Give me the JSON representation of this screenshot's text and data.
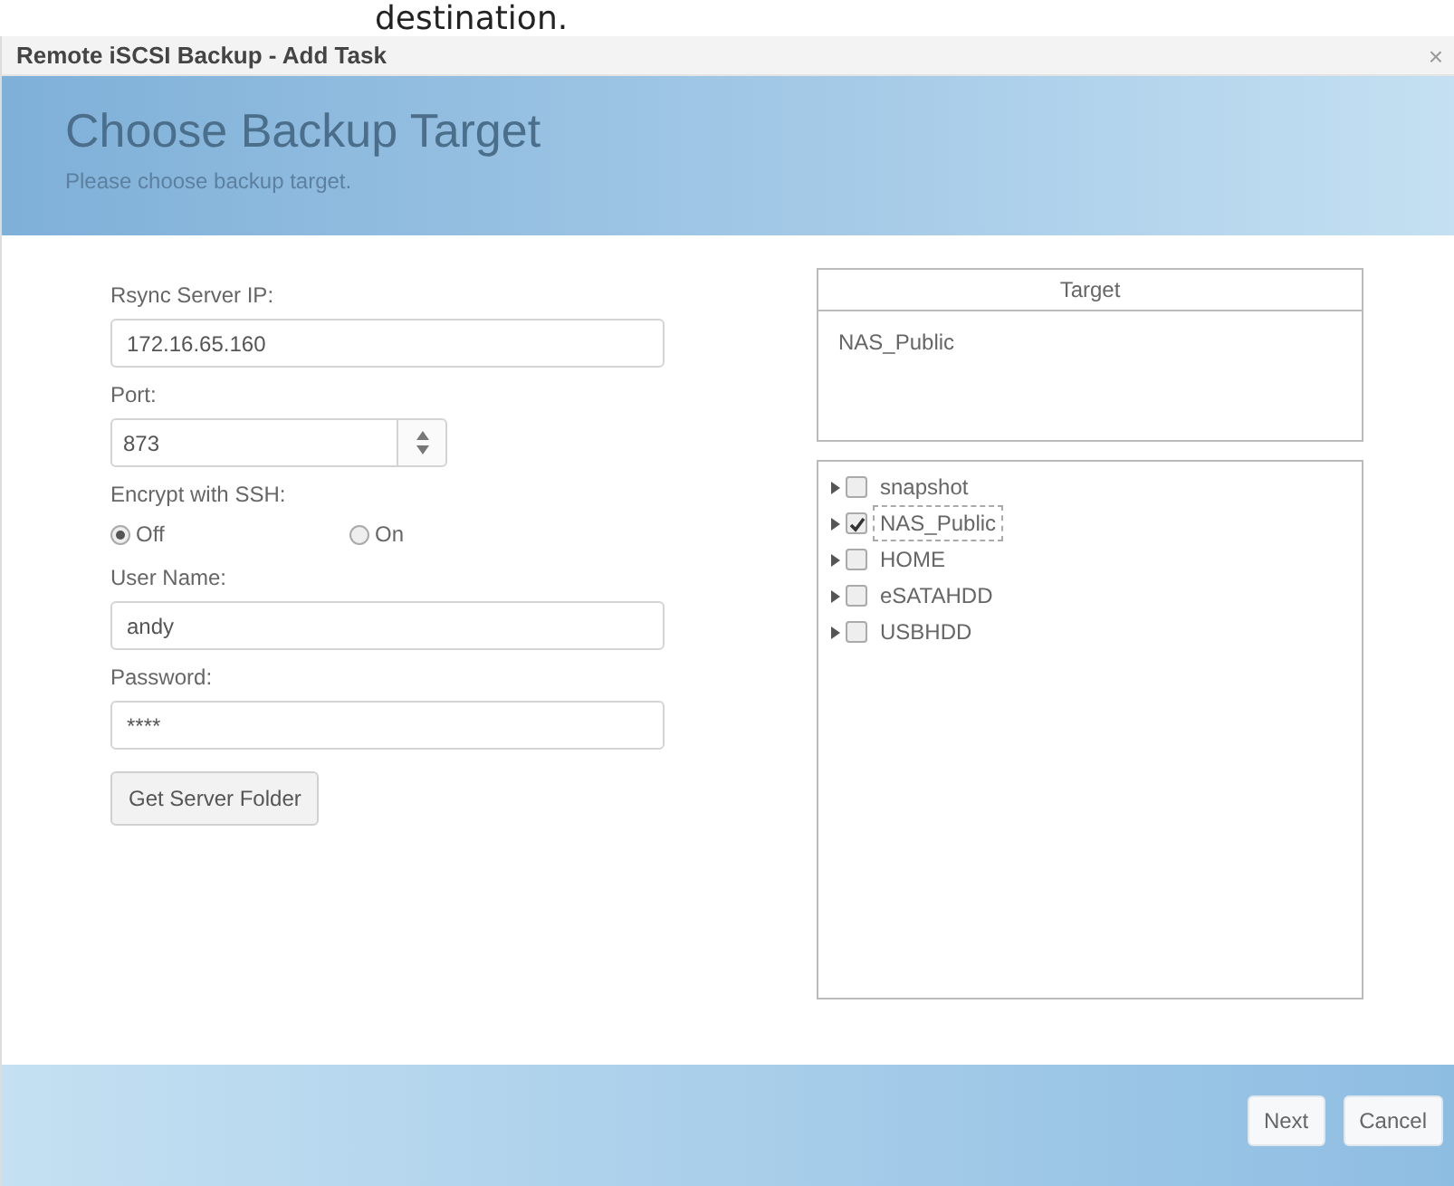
{
  "page_caption": "destination.",
  "window": {
    "title": "Remote iSCSI Backup - Add Task",
    "close": "×"
  },
  "header": {
    "title": "Choose Backup Target",
    "subtitle": "Please choose backup target."
  },
  "form": {
    "server_ip": {
      "label": "Rsync Server IP:",
      "value": "172.16.65.160"
    },
    "port": {
      "label": "Port:",
      "value": "873"
    },
    "encrypt": {
      "label": "Encrypt with SSH:",
      "options": [
        {
          "label": "Off",
          "selected": true
        },
        {
          "label": "On",
          "selected": false
        }
      ]
    },
    "user_name": {
      "label": "User Name:",
      "value": "andy"
    },
    "password": {
      "label": "Password:",
      "value": "****"
    },
    "get_folder_button": "Get Server Folder"
  },
  "target": {
    "heading": "Target",
    "value": "NAS_Public"
  },
  "folders": [
    {
      "label": "snapshot",
      "checked": false,
      "selected": false,
      "expanded": false
    },
    {
      "label": "NAS_Public",
      "checked": true,
      "selected": true,
      "expanded": false
    },
    {
      "label": "HOME",
      "checked": false,
      "selected": false,
      "expanded": false
    },
    {
      "label": "eSATAHDD",
      "checked": false,
      "selected": false,
      "expanded": false
    },
    {
      "label": "USBHDD",
      "checked": false,
      "selected": false,
      "expanded": false
    }
  ],
  "buttons": [
    "Next",
    "Cancel"
  ]
}
